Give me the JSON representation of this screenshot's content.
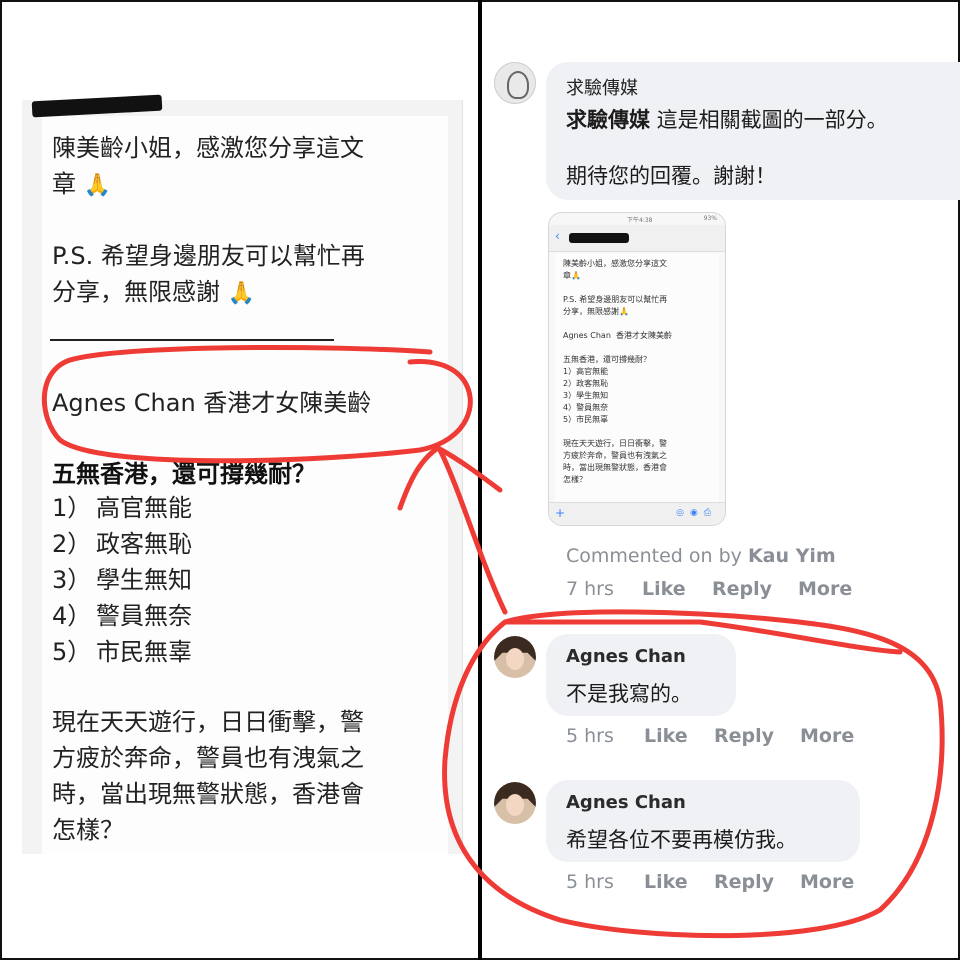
{
  "left_message": {
    "line1": "陳美齡小姐，感激您分享這文",
    "line2": "章",
    "line3": "P.S. 希望身邊朋友可以幫忙再",
    "line4": "分享，無限感謝",
    "headline": "Agnes Chan  香港才女陳美齡",
    "subhead": "五無香港，還可撐幾耐？",
    "list": [
      {
        "num": "1）",
        "text": "高官無能"
      },
      {
        "num": "2）",
        "text": "政客無恥"
      },
      {
        "num": "3）",
        "text": "學生無知"
      },
      {
        "num": "4）",
        "text": "警員無奈"
      },
      {
        "num": "5）",
        "text": "市民無辜"
      }
    ],
    "para": [
      "現在天天遊行，日日衝擊，警",
      "方疲於奔命，警員也有洩氣之",
      "時，當出現無警狀態，香港會",
      "怎樣？"
    ],
    "emoji": "🙏"
  },
  "comments": [
    {
      "name": "求驗傳媒",
      "body_bold": "求驗傳媒",
      "body_rest": " 這是相關截圖的一部分。",
      "body2": "期待您的回覆。謝謝！",
      "meta_prefix": "Commented on by ",
      "meta_author": "Kau Yim",
      "time": "7 hrs",
      "like": "Like",
      "reply": "Reply",
      "more": "More"
    },
    {
      "name": "Agnes Chan",
      "body": "不是我寫的。",
      "time": "5 hrs",
      "like": "Like",
      "reply": "Reply",
      "more": "More"
    },
    {
      "name": "Agnes Chan",
      "body": "希望各位不要再模仿我。",
      "time": "5 hrs",
      "like": "Like",
      "reply": "Reply",
      "more": "More"
    }
  ],
  "thumbnail": {
    "status": "下午4:38",
    "battery": "93%",
    "lines": [
      "陳美齡小姐，感激您分享這文",
      "章🙏",
      "",
      "P.S. 希望身邊朋友可以幫忙再",
      "分享，無限感謝🙏",
      "",
      "Agnes Chan  香港才女陳美齡",
      "",
      "五無香港，還可撐幾耐？",
      "1）高官無能",
      "2）政客無恥",
      "3）學生無知",
      "4）警員無奈",
      "5）市民無辜",
      "",
      "現在天天遊行，日日衝擊，警",
      "方疲於奔命，警員也有洩氣之",
      "時，當出現無警狀態，香港會",
      "怎樣？"
    ]
  },
  "colors": {
    "annotation_red": "#ee3b35",
    "comment_bg": "#eff1f4",
    "meta_gray": "#8a8f96"
  }
}
